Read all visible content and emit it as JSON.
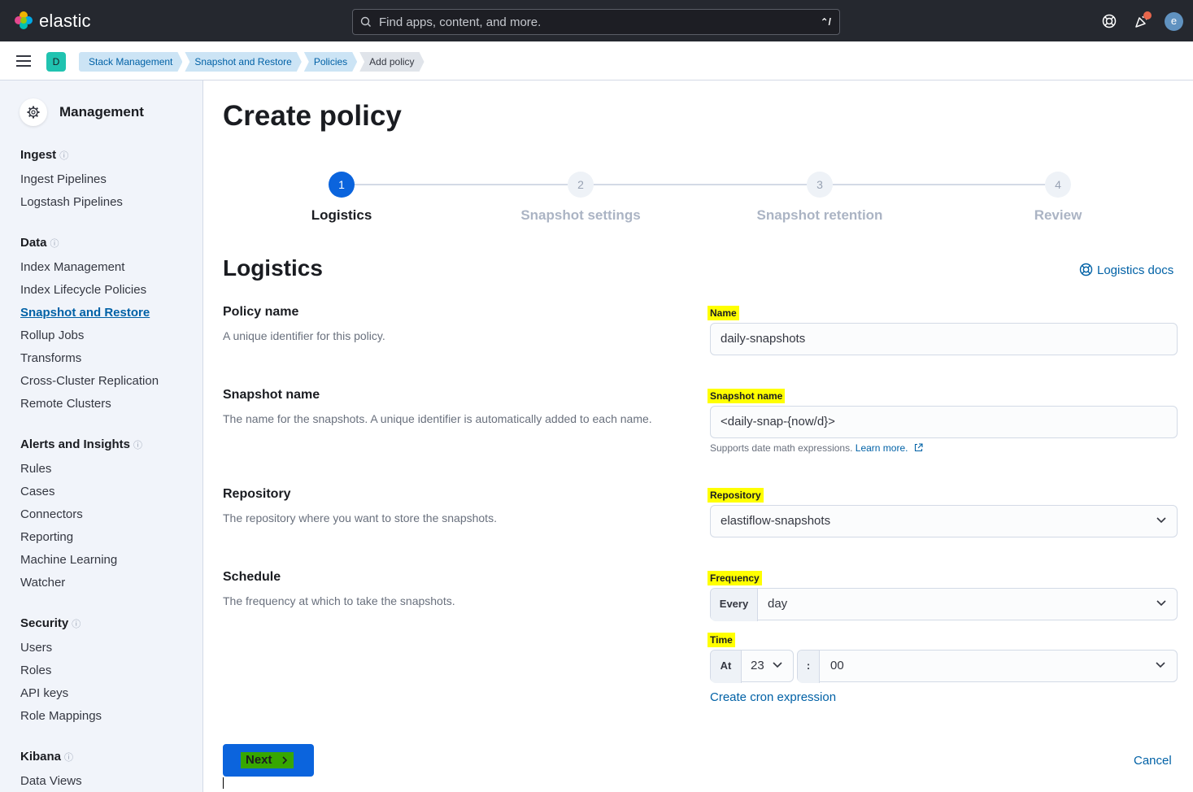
{
  "header": {
    "brand": "elastic",
    "search_placeholder": "Find apps, content, and more.",
    "search_shortcut": "⌃/",
    "user_initial": "e"
  },
  "subheader": {
    "space_initial": "D",
    "breadcrumbs": [
      "Stack Management",
      "Snapshot and Restore",
      "Policies",
      "Add policy"
    ]
  },
  "sidebar": {
    "title": "Management",
    "groups": [
      {
        "label": "Ingest",
        "items": [
          "Ingest Pipelines",
          "Logstash Pipelines"
        ]
      },
      {
        "label": "Data",
        "items": [
          "Index Management",
          "Index Lifecycle Policies",
          "Snapshot and Restore",
          "Rollup Jobs",
          "Transforms",
          "Cross-Cluster Replication",
          "Remote Clusters"
        ]
      },
      {
        "label": "Alerts and Insights",
        "items": [
          "Rules",
          "Cases",
          "Connectors",
          "Reporting",
          "Machine Learning",
          "Watcher"
        ]
      },
      {
        "label": "Security",
        "items": [
          "Users",
          "Roles",
          "API keys",
          "Role Mappings"
        ]
      },
      {
        "label": "Kibana",
        "items": [
          "Data Views"
        ]
      }
    ],
    "active_item": "Snapshot and Restore"
  },
  "main": {
    "title": "Create policy",
    "steps": [
      {
        "number": "1",
        "label": "Logistics"
      },
      {
        "number": "2",
        "label": "Snapshot settings"
      },
      {
        "number": "3",
        "label": "Snapshot retention"
      },
      {
        "number": "4",
        "label": "Review"
      }
    ],
    "active_step": 1,
    "section_title": "Logistics",
    "docs_link": "Logistics docs",
    "rows": {
      "policy_name": {
        "title": "Policy name",
        "desc": "A unique identifier for this policy.",
        "label": "Name",
        "value": "daily-snapshots"
      },
      "snapshot_name": {
        "title": "Snapshot name",
        "desc": "The name for the snapshots. A unique identifier is automatically added to each name.",
        "label": "Snapshot name",
        "value": "<daily-snap-{now/d}>",
        "help": "Supports date math expressions.",
        "help_link": "Learn more."
      },
      "repository": {
        "title": "Repository",
        "desc": "The repository where you want to store the snapshots.",
        "label": "Repository",
        "value": "elastiflow-snapshots"
      },
      "schedule": {
        "title": "Schedule",
        "desc": "The frequency at which to take the snapshots.",
        "frequency_label": "Frequency",
        "frequency_prepend": "Every",
        "frequency_value": "day",
        "time_label": "Time",
        "time_prepend": "At",
        "hour": "23",
        "separator": ":",
        "minute": "00",
        "cron_link": "Create cron expression"
      }
    },
    "next_label": "Next",
    "cancel_label": "Cancel"
  }
}
